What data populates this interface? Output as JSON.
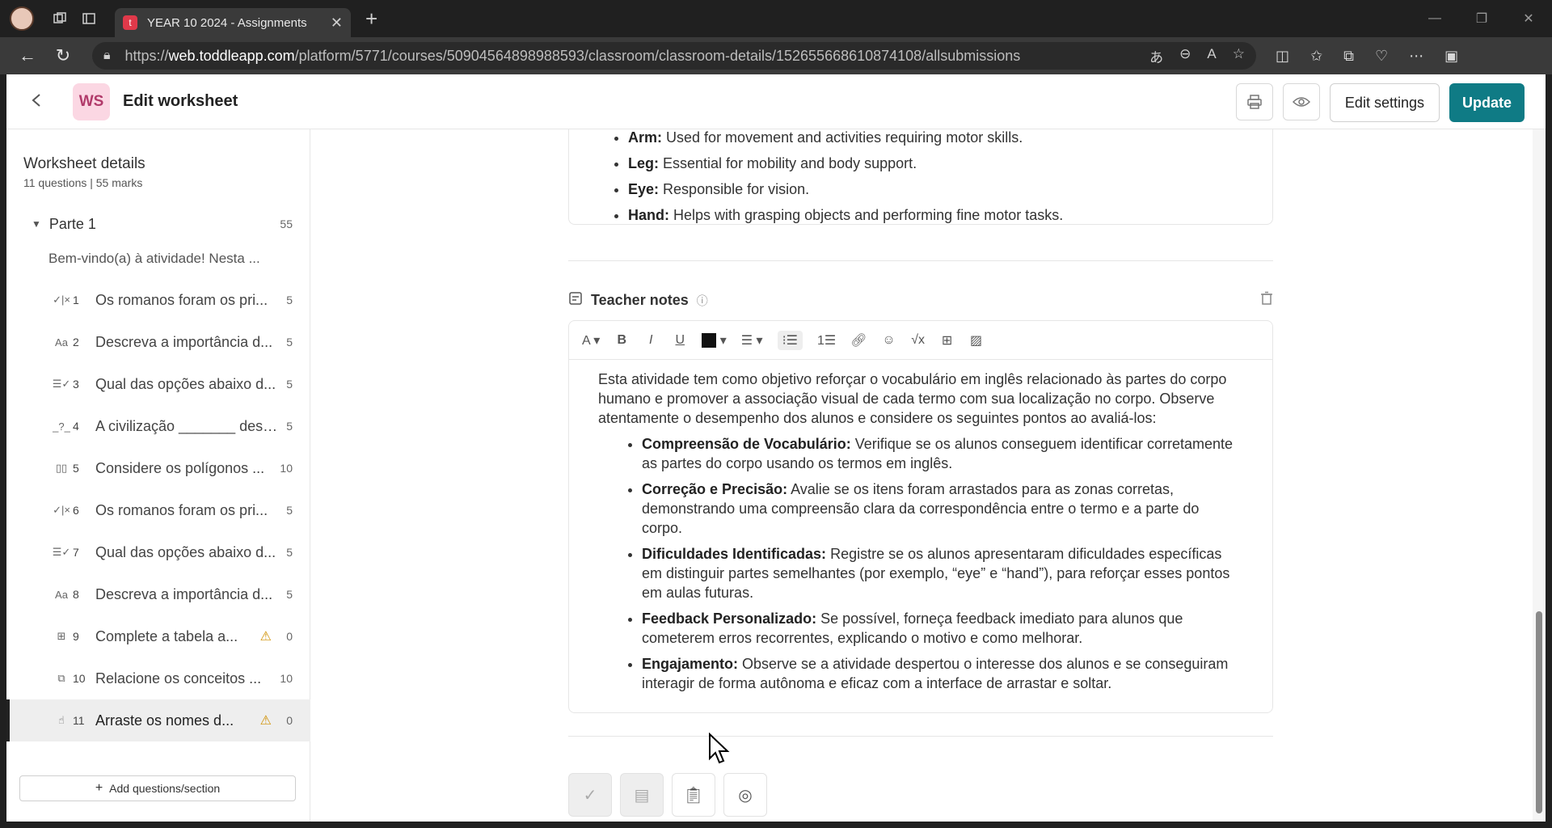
{
  "browser": {
    "tab_title": "YEAR 10 2024 - Assignments",
    "tab_favicon": "t",
    "url_prefix": "https://",
    "url_host": "web.toddleapp.com",
    "url_path": "/platform/5771/courses/50904564898988593/classroom/classroom-details/152655668610874108/allsubmissions"
  },
  "header": {
    "badge": "WS",
    "title": "Edit worksheet",
    "edit_settings": "Edit settings",
    "update": "Update"
  },
  "sidebar": {
    "heading": "Worksheet details",
    "subheading": "11 questions | 55 marks",
    "section_label": "Parte 1",
    "section_marks": "55",
    "intro": "Bem-vindo(a) à atividade! Nesta ...",
    "questions": [
      {
        "num": "1",
        "icon": "✓|×",
        "title": "Os romanos foram os pri...",
        "marks": "5",
        "warn": false
      },
      {
        "num": "2",
        "icon": "Aa",
        "title": "Descreva a importância d...",
        "marks": "5",
        "warn": false
      },
      {
        "num": "3",
        "icon": "☰✓",
        "title": "Qual das opções abaixo d...",
        "marks": "5",
        "warn": false
      },
      {
        "num": "4",
        "icon": "_?_",
        "title": "A civilização _______ dese...",
        "marks": "5",
        "warn": false
      },
      {
        "num": "5",
        "icon": "▯▯",
        "title": "Considere os polígonos ...",
        "marks": "10",
        "warn": false
      },
      {
        "num": "6",
        "icon": "✓|×",
        "title": "Os romanos foram os pri...",
        "marks": "5",
        "warn": false
      },
      {
        "num": "7",
        "icon": "☰✓",
        "title": "Qual das opções abaixo d...",
        "marks": "5",
        "warn": false
      },
      {
        "num": "8",
        "icon": "Aa",
        "title": "Descreva a importância d...",
        "marks": "5",
        "warn": false
      },
      {
        "num": "9",
        "icon": "⊞",
        "title": "Complete a tabela a...",
        "marks": "0",
        "warn": true
      },
      {
        "num": "10",
        "icon": "⧉",
        "title": "Relacione os conceitos ...",
        "marks": "10",
        "warn": false
      },
      {
        "num": "11",
        "icon": "☝",
        "title": "Arraste os nomes d...",
        "marks": "0",
        "warn": true
      }
    ],
    "add_button": "Add questions/section"
  },
  "content": {
    "body_parts": [
      {
        "term": "Arm:",
        "desc": "Used for movement and activities requiring motor skills."
      },
      {
        "term": "Leg:",
        "desc": "Essential for mobility and body support."
      },
      {
        "term": "Eye:",
        "desc": "Responsible for vision."
      },
      {
        "term": "Hand:",
        "desc": "Helps with grasping objects and performing fine motor tasks."
      }
    ],
    "teacher_notes_label": "Teacher notes",
    "notes_intro": "Esta atividade tem como objetivo reforçar o vocabulário em inglês relacionado às partes do corpo humano e promover a associação visual de cada termo com sua localização no corpo. Observe atentamente o desempenho dos alunos e considere os seguintes pontos ao avaliá-los:",
    "notes_points": [
      {
        "term": "Compreensão de Vocabulário:",
        "desc": "Verifique se os alunos conseguem identificar corretamente as partes do corpo usando os termos em inglês."
      },
      {
        "term": "Correção e Precisão:",
        "desc": "Avalie se os itens foram arrastados para as zonas corretas, demonstrando uma compreensão clara da correspondência entre o termo e a parte do corpo."
      },
      {
        "term": "Dificuldades Identificadas:",
        "desc": "Registre se os alunos apresentaram dificuldades específicas em distinguir partes semelhantes (por exemplo, “eye” e “hand”), para reforçar esses pontos em aulas futuras."
      },
      {
        "term": "Feedback Personalizado:",
        "desc": "Se possível, forneça feedback imediato para alunos que cometerem erros recorrentes, explicando o motivo e como melhorar."
      },
      {
        "term": "Engajamento:",
        "desc": "Observe se a atividade despertou o interesse dos alunos e se conseguiram interagir de forma autônoma e eficaz com a interface de arrastar e soltar."
      }
    ]
  },
  "colors": {
    "primary": "#0f7b85",
    "badge_bg": "#fbd7e3",
    "warning": "#d09000"
  }
}
